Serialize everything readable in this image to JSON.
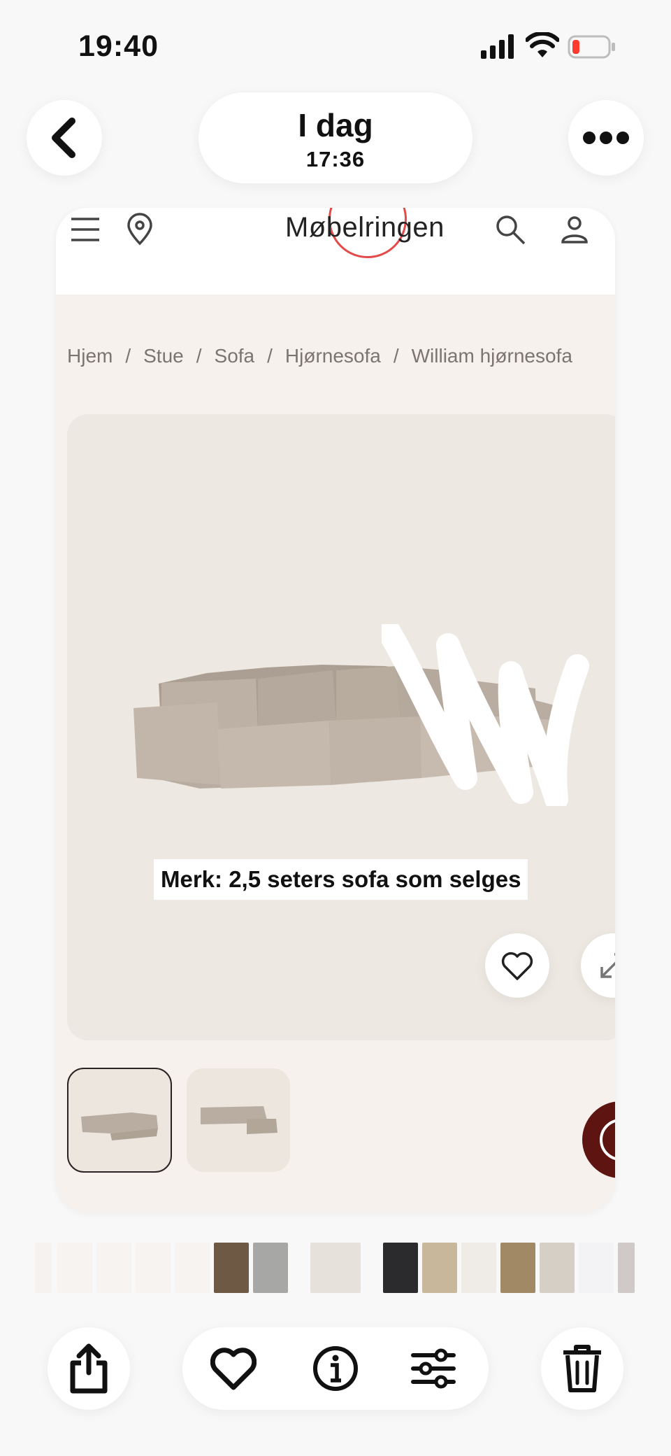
{
  "status": {
    "time": "19:40"
  },
  "nav": {
    "date_title": "I dag",
    "date_time": "17:36"
  },
  "site": {
    "logo": "Møbelringen",
    "logo_color": "#e34b4b",
    "breadcrumb": [
      "Hjem",
      "Stue",
      "Sofa",
      "Hjørnesofa",
      "William hjørnesofa"
    ],
    "breadcrumb_separator": "/",
    "caption": "Merk: 2,5 seters sofa som selges",
    "chat_color": "#5e1512"
  },
  "icons": {
    "back": "chevron-left-icon",
    "more": "ellipsis-icon",
    "menu": "hamburger-icon",
    "location": "location-pin-icon",
    "search": "search-icon",
    "account": "user-icon",
    "favorite": "heart-icon",
    "expand": "expand-icon",
    "share": "share-icon",
    "like": "heart-icon",
    "info": "info-icon",
    "adjust": "sliders-icon",
    "delete": "trash-icon"
  }
}
